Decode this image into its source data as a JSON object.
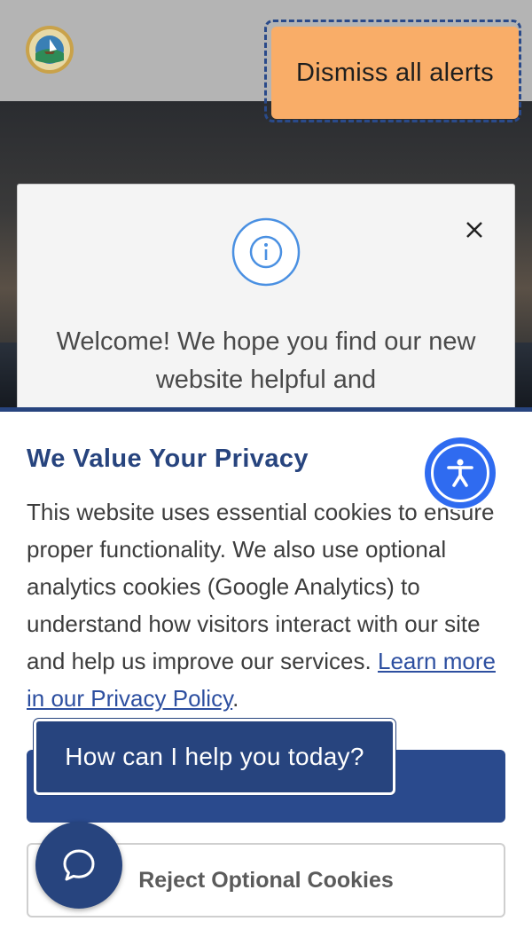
{
  "header": {
    "seal_icon": "county-seal-icon",
    "dismiss_label": "Dismiss all alerts"
  },
  "alert": {
    "icon": "info-icon",
    "close_icon": "close-icon",
    "text": "Welcome! We hope you find our new website helpful and"
  },
  "privacy": {
    "title": "We Value Your Privacy",
    "body": "This website uses essential cookies to ensure proper functionality. We also use optional analytics cookies (Google Analytics) to understand how visitors interact with our site and help us improve our services.",
    "link_label": "Learn more in our Privacy Policy",
    "after_link": ".",
    "accept_label": "",
    "reject_label": "Reject Optional Cookies"
  },
  "accessibility": {
    "icon": "accessibility-icon"
  },
  "chat": {
    "tooltip": "How can I help you today?",
    "icon": "chat-bubble-icon"
  },
  "colors": {
    "brand_navy": "#27447e",
    "dismiss_orange": "#f9ad68",
    "accessibility_blue": "#2f6bf0"
  }
}
